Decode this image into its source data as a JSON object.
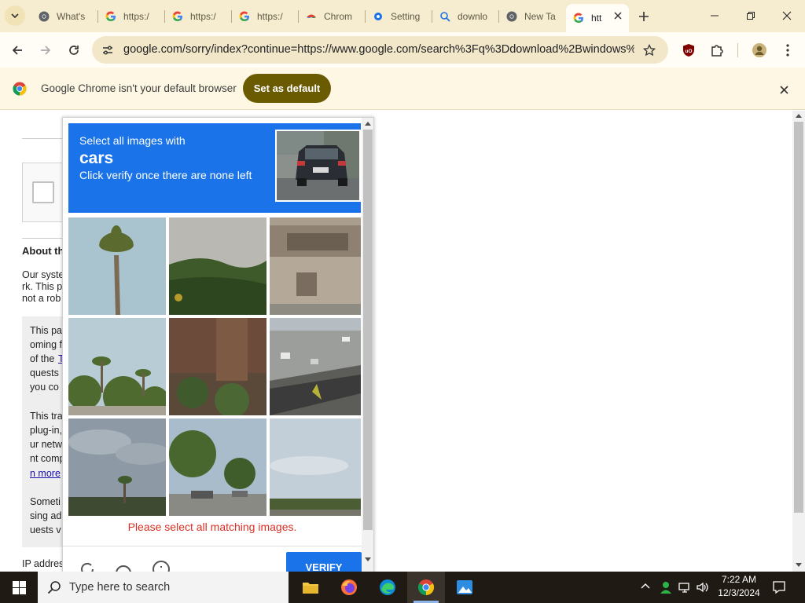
{
  "browser": {
    "tabs": [
      {
        "label": "What's",
        "icon": "chrome-icon"
      },
      {
        "label": "https:/",
        "icon": "google-icon"
      },
      {
        "label": "https:/",
        "icon": "google-icon"
      },
      {
        "label": "https:/",
        "icon": "google-icon"
      },
      {
        "label": "Chrom",
        "icon": "chrome-web-store-icon"
      },
      {
        "label": "Setting",
        "icon": "settings-gear-icon"
      },
      {
        "label": "downlo",
        "icon": "search-icon"
      },
      {
        "label": "New Ta",
        "icon": "chrome-icon"
      },
      {
        "label": "htt",
        "icon": "google-icon"
      }
    ],
    "url": "google.com/sorry/index?continue=https://www.google.com/search%3Fq%3Ddownload%2Bwindows%..."
  },
  "infobar": {
    "message": "Google Chrome isn't your default browser",
    "button": "Set as default"
  },
  "page": {
    "about_heading": "About th",
    "lines_a": [
      "Our syste",
      "rk. This p",
      "not a rob"
    ],
    "lines_b": [
      "This pa",
      "oming f",
      "of the ",
      "quests",
      "you co"
    ],
    "link_t": "T",
    "lines_c": [
      "This tra",
      "plug-in,",
      "ur netw",
      "nt comp"
    ],
    "learn_more": "n more",
    "lines_d": [
      "Someti",
      "sing ad",
      "uests v"
    ],
    "ip_label": "IP addres"
  },
  "captcha": {
    "prompt_line1": "Select all images with",
    "target": "cars",
    "prompt_line2": "Click verify once there are none left",
    "error": "Please select all matching images.",
    "verify_label": "VERIFY",
    "tiles": [
      {
        "subject": "palm tree against sky"
      },
      {
        "subject": "hillside with trees"
      },
      {
        "subject": "store front building sign"
      },
      {
        "subject": "palm trees and shrubs"
      },
      {
        "subject": "brick wall with plants"
      },
      {
        "subject": "highway with cars"
      },
      {
        "subject": "cloudy sky with palm"
      },
      {
        "subject": "trees and parked car"
      },
      {
        "subject": "sky with treeline"
      }
    ]
  },
  "taskbar": {
    "search_placeholder": "Type here to search",
    "time": "7:22 AM",
    "date": "12/3/2024"
  },
  "colors": {
    "captcha_blue": "#1a73e8",
    "error_red": "#d93025",
    "set_default_bg": "#6a5a00",
    "tabstrip_bg": "#f6eccf"
  }
}
